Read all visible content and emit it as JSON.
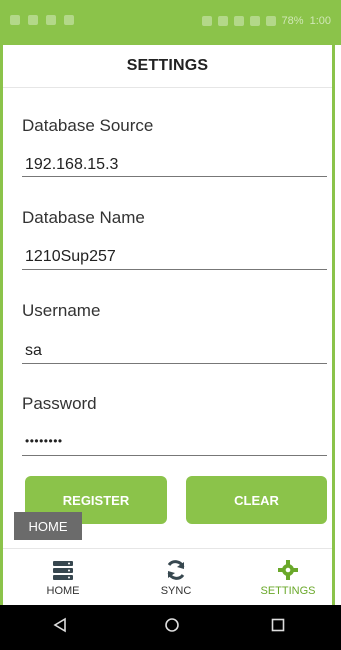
{
  "status_bar": {
    "battery": "78%",
    "time": "1:00"
  },
  "header": {
    "title": "SETTINGS"
  },
  "fields": [
    {
      "label": "Database Source",
      "value": "192.168.15.3"
    },
    {
      "label": "Database Name",
      "value": "1210Sup257"
    },
    {
      "label": "Username",
      "value": "sa"
    },
    {
      "label": "Password",
      "value": "••••••••"
    }
  ],
  "buttons": {
    "register": "REGISTER",
    "clear": "CLEAR"
  },
  "toast": "HOME",
  "bottom_nav": [
    {
      "label": "HOME",
      "icon": "server-icon"
    },
    {
      "label": "SYNC",
      "icon": "sync-icon"
    },
    {
      "label": "SETTINGS",
      "icon": "gear-icon",
      "active": true
    }
  ],
  "colors": {
    "accent": "#8bc34a",
    "active_text": "#6aa82a"
  }
}
